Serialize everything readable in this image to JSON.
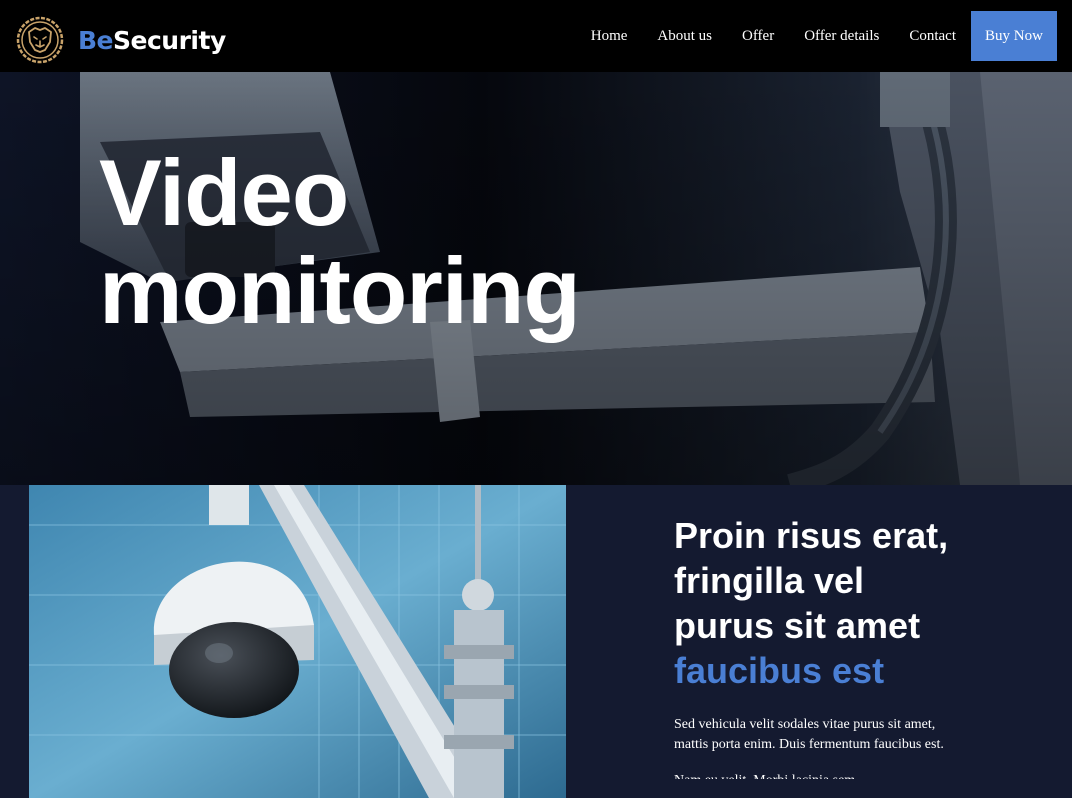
{
  "brand": {
    "prefix": "Be",
    "suffix": "Security",
    "logo_icon": "lion-badge-icon",
    "accent_color": "#4a7fd4"
  },
  "nav": {
    "items": [
      "Home",
      "About us",
      "Offer",
      "Offer details",
      "Contact"
    ],
    "cta": "Buy Now"
  },
  "hero": {
    "line1": "Video",
    "line2": "monitoring"
  },
  "section": {
    "heading_lines": [
      "Proin risus erat,",
      "fringilla vel",
      "purus sit amet"
    ],
    "heading_accent": "faucibus est",
    "body": "Sed vehicula velit sodales vitae purus sit amet, mattis porta enim. Duis fermentum faucibus est.",
    "next_line": "Nam eu velit. Morbi lacinia sem"
  }
}
